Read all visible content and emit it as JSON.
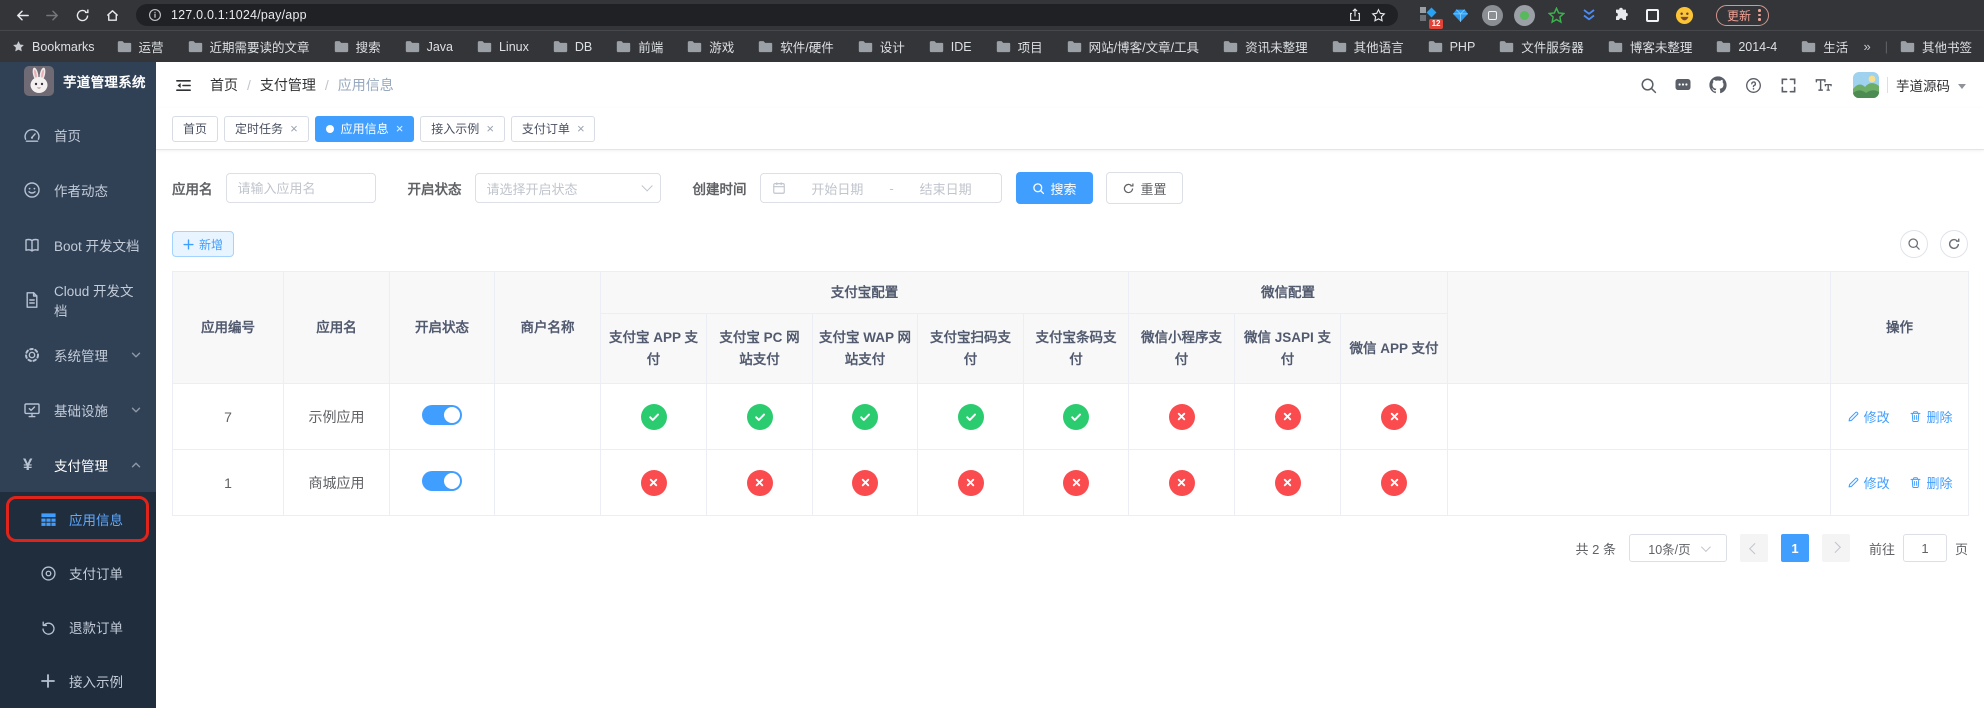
{
  "browser": {
    "url": "127.0.0.1:1024/pay/app",
    "extension_badge": "12",
    "update_button": "更新",
    "bookmarks_label": "Bookmarks",
    "bookmarks": [
      "运营",
      "近期需要读的文章",
      "搜索",
      "Java",
      "Linux",
      "DB",
      "前端",
      "游戏",
      "软件/硬件",
      "设计",
      "IDE",
      "项目",
      "网站/博客/文章/工具",
      "资讯未整理",
      "其他语言",
      "PHP",
      "文件服务器",
      "博客未整理",
      "2014-4",
      "生活"
    ],
    "bookmarks_overflow": "»",
    "other_bookmarks": "其他书签"
  },
  "glyphs": {
    "close": "×",
    "dash": "-"
  },
  "sidebar": {
    "logo_title": "芋道管理系统",
    "items": [
      {
        "key": "home",
        "label": "首页",
        "icon": "dashboard-icon",
        "expandable": false
      },
      {
        "key": "author-news",
        "label": "作者动态",
        "icon": "author-icon",
        "expandable": false
      },
      {
        "key": "boot-docs",
        "label": "Boot 开发文档",
        "icon": "book-icon",
        "expandable": false
      },
      {
        "key": "cloud-docs",
        "label": "Cloud 开发文档",
        "icon": "doc-icon",
        "expandable": false
      },
      {
        "key": "system-admin",
        "label": "系统管理",
        "icon": "gear-icon",
        "expandable": true,
        "expanded": false
      },
      {
        "key": "infrastructure",
        "label": "基础设施",
        "icon": "monitor-icon",
        "expandable": true,
        "expanded": false
      },
      {
        "key": "pay-admin",
        "label": "支付管理",
        "icon": "yen-icon",
        "expandable": true,
        "expanded": true,
        "active": true
      }
    ],
    "submenu": [
      {
        "key": "app-info",
        "label": "应用信息",
        "icon": "grid-icon",
        "active": true,
        "highlighted": true
      },
      {
        "key": "pay-order",
        "label": "支付订单",
        "icon": "order-icon"
      },
      {
        "key": "refund-order",
        "label": "退款订单",
        "icon": "refund-icon"
      },
      {
        "key": "integration-demo",
        "label": "接入示例",
        "icon": "plus-icon"
      }
    ]
  },
  "header": {
    "breadcrumb": [
      "首页",
      "支付管理",
      "应用信息"
    ],
    "breadcrumb_separator": "/",
    "user_name": "芋道源码"
  },
  "tabs": [
    {
      "label": "首页",
      "closable": false,
      "active": false
    },
    {
      "label": "定时任务",
      "closable": true,
      "active": false
    },
    {
      "label": "应用信息",
      "closable": true,
      "active": true
    },
    {
      "label": "接入示例",
      "closable": true,
      "active": false
    },
    {
      "label": "支付订单",
      "closable": true,
      "active": false
    }
  ],
  "filters": {
    "app_name_label": "应用名",
    "app_name_placeholder": "请输入应用名",
    "status_label": "开启状态",
    "status_placeholder": "请选择开启状态",
    "create_time_label": "创建时间",
    "date_start_placeholder": "开始日期",
    "date_separator": "-",
    "date_end_placeholder": "结束日期",
    "search_button": "搜索",
    "reset_button": "重置"
  },
  "toolbar": {
    "add_button": "新增"
  },
  "table": {
    "simple_headers": [
      "应用编号",
      "应用名",
      "开启状态",
      "商户名称"
    ],
    "groups": [
      {
        "label": "支付宝配置",
        "children": [
          "支付宝 APP 支付",
          "支付宝 PC 网站支付",
          "支付宝 WAP 网站支付",
          "支付宝扫码支付",
          "支付宝条码支付"
        ]
      },
      {
        "label": "微信配置",
        "children": [
          "微信小程序支付",
          "微信 JSAPI 支付",
          "微信 APP 支付"
        ]
      }
    ],
    "action_header": "操作",
    "edit_label": "修改",
    "delete_label": "删除",
    "rows": [
      {
        "app_id": "7",
        "app_name": "示例应用",
        "enabled": true,
        "merchant": "",
        "alipay": [
          true,
          true,
          true,
          true,
          true
        ],
        "wechat": [
          false,
          false,
          false
        ]
      },
      {
        "app_id": "1",
        "app_name": "商城应用",
        "enabled": true,
        "merchant": "",
        "alipay": [
          false,
          false,
          false,
          false,
          false
        ],
        "wechat": [
          false,
          false,
          false
        ]
      }
    ]
  },
  "pagination": {
    "total_text": "共 2 条",
    "page_size": "10条/页",
    "current_page": "1",
    "goto_label": "前往",
    "goto_value": "1",
    "page_suffix": "页"
  },
  "colors": {
    "primary": "#409eff",
    "success": "#2bcb70",
    "danger": "#fa4b4e",
    "sidebar_bg": "#304156",
    "submenu_bg": "#1f2d3d",
    "annotation": "#e0241b"
  }
}
